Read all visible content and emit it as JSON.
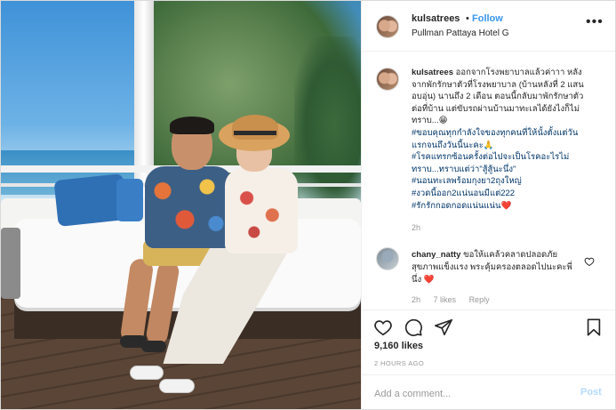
{
  "header": {
    "username": "kulsatrees",
    "separator": "•",
    "follow_label": "Follow",
    "location": "Pullman Pattaya Hotel G",
    "more_icon": "more-options-icon"
  },
  "caption": {
    "username": "kulsatrees",
    "text": "ออกจากโรงพยาบาลแล้วค่าาา หลังจากพักรักษาตัวที่โรงพยาบาล (บ้านหลังที่ 2 แสนอบอุ่น) นานถึง 2 เดือน ตอนนี้กลับมาพักรักษาตัวต่อที่บ้าน แต่ขับรถผ่านบ้านมาทะเลได้ยังไงก็ไม่ทราบ...😁",
    "tags": [
      "#ขอบคุณทุกกำลังใจของทุกคนที่ให้นั้งตั้งแต่วันแรกจนถึงวันนี้นะคะ🙏",
      "#โรคแทรกซ้อนครั้งต่อไปจะเป็นโรคอะไรไม่ทราบ...ทราบแต่ว่า\"สู้สู้นะนึ่ง\"",
      "#นอนทะเลพร้อมกุงยา2ถุงใหญ่",
      "#งวดนี้ออก2แน่นอนมีแต่222",
      "#รักรักกอดกอดแน่นแน่น❤️"
    ],
    "time": "2h"
  },
  "comment": {
    "username": "chany_natty",
    "text": "ขอให้แคล้วคลาดปลอดภัย สุขภาพแข็งแรง พระคุ้มครองตลอดไปนะคะพี่นึ่ง ❤️",
    "time": "2h",
    "likes": "7 likes",
    "reply_label": "Reply"
  },
  "actions": {
    "likes": "9,160 likes",
    "posted_ago": "2 HOURS AGO",
    "add_comment_placeholder": "Add a comment...",
    "post_label": "Post"
  },
  "colors": {
    "link_blue": "#3897f0",
    "hashtag": "#003569",
    "muted": "#999999",
    "heart_red": "#ed4956"
  }
}
